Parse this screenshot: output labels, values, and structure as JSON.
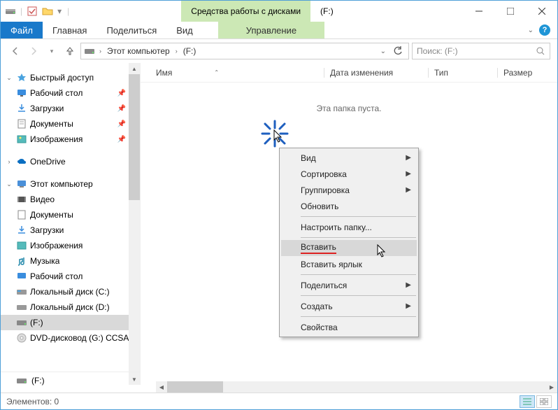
{
  "titlebar": {
    "contextual_tab": "Средства работы с дисками",
    "window_title": "(F:)"
  },
  "ribbon": {
    "file": "Файл",
    "home": "Главная",
    "share": "Поделиться",
    "view": "Вид",
    "manage": "Управление"
  },
  "breadcrumb": {
    "seg1": "Этот компьютер",
    "seg2": "(F:)"
  },
  "search": {
    "placeholder": "Поиск: (F:)"
  },
  "sidebar": {
    "quick": "Быстрый доступ",
    "desktop": "Рабочий стол",
    "downloads": "Загрузки",
    "documents": "Документы",
    "pictures": "Изображения",
    "onedrive": "OneDrive",
    "thispc": "Этот компьютер",
    "videos": "Видео",
    "documents2": "Документы",
    "downloads2": "Загрузки",
    "pictures2": "Изображения",
    "music": "Музыка",
    "desktop2": "Рабочий стол",
    "localc": "Локальный диск (C:)",
    "locald": "Локальный диск (D:)",
    "f": "(F:)",
    "dvd": "DVD-дисковод (G:) CCSA_X",
    "footer_f": "(F:)"
  },
  "columns": {
    "name": "Имя",
    "date": "Дата изменения",
    "type": "Тип",
    "size": "Размер"
  },
  "empty_folder": "Эта папка пуста.",
  "status": {
    "elements": "Элементов: 0"
  },
  "context_menu": {
    "view": "Вид",
    "sort": "Сортировка",
    "group": "Группировка",
    "refresh": "Обновить",
    "customize": "Настроить папку...",
    "paste": "Вставить",
    "paste_shortcut": "Вставить ярлык",
    "share": "Поделиться",
    "new": "Создать",
    "properties": "Свойства"
  }
}
